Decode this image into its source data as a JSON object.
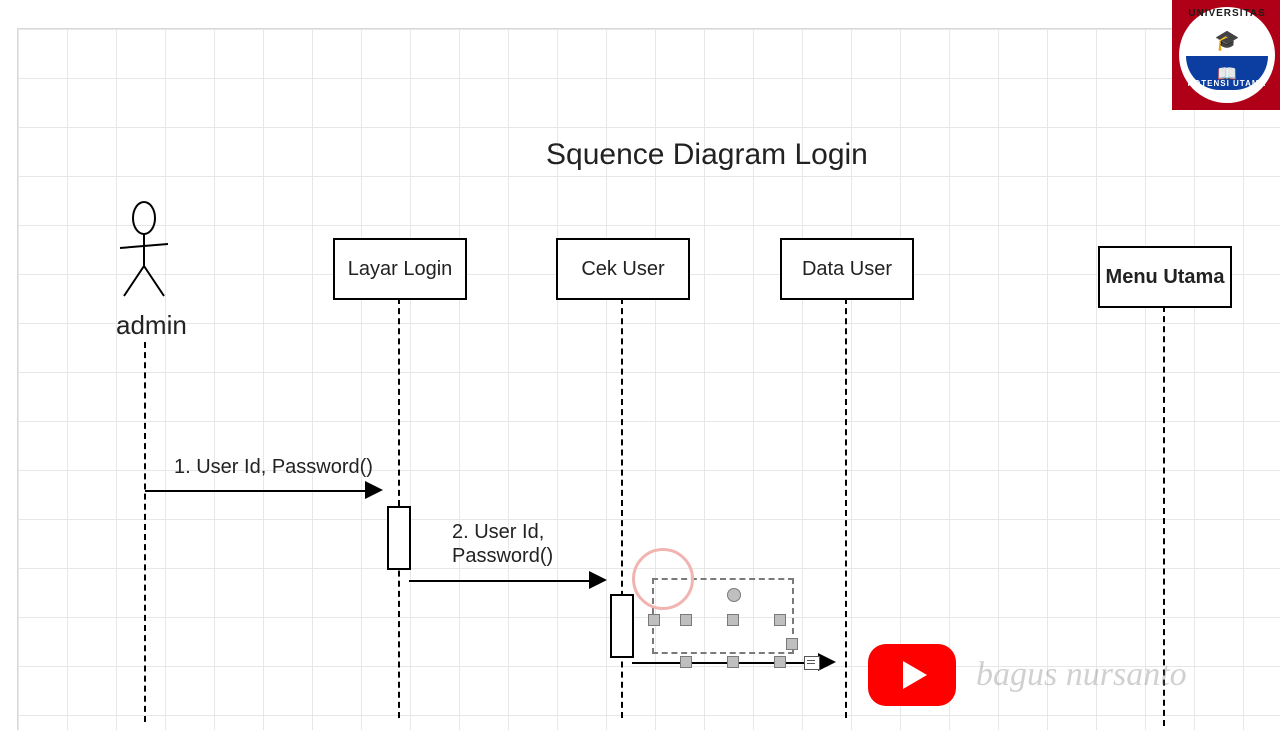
{
  "title": "Squence Diagram Login",
  "actor": {
    "name": "admin"
  },
  "lifelines": [
    {
      "id": "layar-login",
      "label": "Layar Login"
    },
    {
      "id": "cek-user",
      "label": "Cek User"
    },
    {
      "id": "data-user",
      "label": "Data User"
    },
    {
      "id": "menu-utama",
      "label": "Menu Utama"
    }
  ],
  "messages": [
    {
      "id": "m1",
      "from": "admin",
      "to": "layar-login",
      "label": "1. User Id, Password()"
    },
    {
      "id": "m2",
      "from": "layar-login",
      "to": "cek-user",
      "label": "2. User Id,\nPassword()"
    },
    {
      "id": "m3",
      "from": "cek-user",
      "to": "data-user",
      "label": "",
      "in_progress": true
    }
  ],
  "logo": {
    "text_top": "UNIVERSITAS",
    "text_bottom": "POTENSI UTAMA",
    "cap_glyph": "🎓",
    "book_glyph": "📖"
  },
  "watermark": "bagus nursanto",
  "colors": {
    "grid": "#e7e7e7",
    "ink": "#000000",
    "logo_red": "#b00018",
    "logo_blue": "#0b3ea0",
    "youtube_red": "#ff0000",
    "click_ring": "#f1b4b0"
  }
}
